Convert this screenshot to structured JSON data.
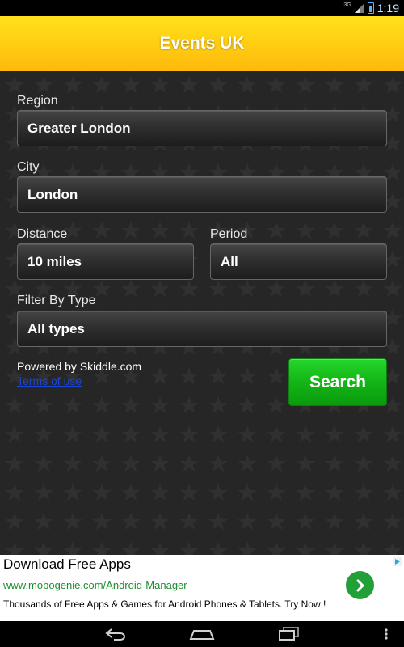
{
  "status_bar": {
    "network_label": "3G",
    "time": "1:19"
  },
  "header": {
    "title": "Events UK"
  },
  "form": {
    "region": {
      "label": "Region",
      "value": "Greater London"
    },
    "city": {
      "label": "City",
      "value": "London"
    },
    "distance": {
      "label": "Distance",
      "value": "10 miles"
    },
    "period": {
      "label": "Period",
      "value": "All"
    },
    "filter_type": {
      "label": "Filter By Type",
      "value": "All types"
    },
    "powered_by": "Powered by Skiddle.com",
    "terms_link": "Terms of use",
    "search_label": "Search"
  },
  "ad": {
    "title": "Download Free Apps",
    "url": "www.mobogenie.com/Android-Manager",
    "description": "Thousands of Free Apps & Games for Android Phones & Tablets. Try Now !"
  },
  "icons": {
    "signal": "signal-icon",
    "battery": "battery-icon",
    "ad_go": "chevron-right-icon",
    "ad_choices": "ad-choices-icon",
    "back": "back-icon",
    "home": "home-icon",
    "recents": "recents-icon",
    "menu": "overflow-menu-icon"
  },
  "colors": {
    "header_yellow": "#ffd012",
    "search_green": "#13b516",
    "link_blue": "#1b46d6",
    "ad_url_green": "#1a8f2e"
  }
}
